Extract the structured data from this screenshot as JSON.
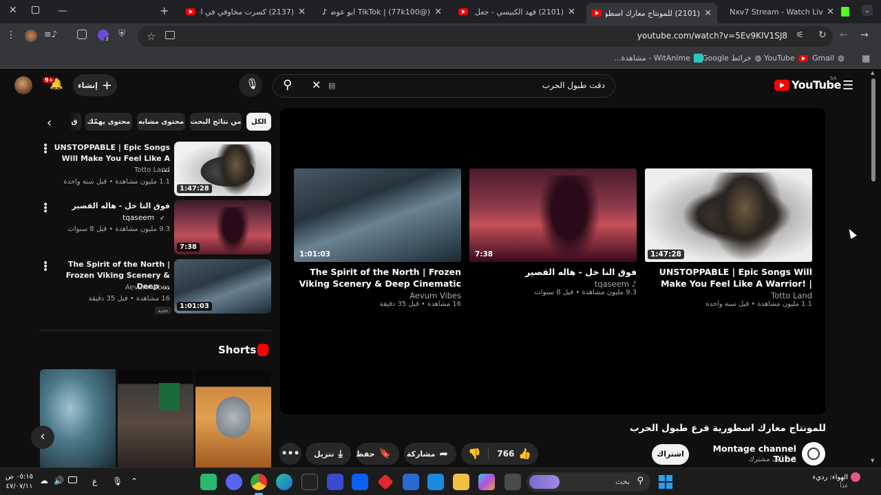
{
  "browser": {
    "tabs": [
      {
        "title": "Nxv7 Stream - Watch Live on Ki",
        "active": false
      },
      {
        "title": "(2101) للمونتاج معارك اسطورية",
        "active": true
      },
      {
        "title": "(2101) فهد الكبيسي - جعل السحا",
        "active": false
      },
      {
        "title": "TikTok | (77k100@) ابو عوضه⭐",
        "active": false
      },
      {
        "title": "(2137) كسرت مخاوفي في اخطر",
        "active": false
      }
    ],
    "url": "youtube.com/watch?v=5Ev9KlV1SJ8",
    "extension_badge": "3",
    "bookmarks": [
      {
        "label": "Gmail"
      },
      {
        "label": "YouTube"
      },
      {
        "label": "خرائط Google"
      },
      {
        "label": "WitAnime - مشاهدة..."
      }
    ]
  },
  "youtube": {
    "logo_text": "YouTube",
    "region": "SA",
    "search_query": "دقت طبول الحرب",
    "create_label": "إنشاء",
    "notif_count": "9+",
    "chips": [
      "الكل",
      "من نتائج البحث",
      "محتوى مشابه",
      "محتوى يهمّك",
      "ق"
    ],
    "sidebar_videos": [
      {
        "title": "UNSTOPPABLE | Epic Songs Will Make You Feel Like A ...",
        "channel": "Totto Land",
        "meta": "1.1 مليون مشاهدة • قبل سنة واحدة",
        "duration": "1:47:28"
      },
      {
        "title": "فوق النا خل - هاله القصير",
        "channel": "tqaseem",
        "meta": "9.3 مليون مشاهدة • قبل 8 سنوات",
        "duration": "7:38"
      },
      {
        "title": "The Spirit of the North | Frozen Viking Scenery & Deep ...",
        "channel": "Aevum Vibes",
        "meta": "16 مشاهدة • قبل 35 دقيقة",
        "duration": "1:01:03",
        "badge": "جديد"
      }
    ],
    "shorts_label": "Shorts",
    "end_cards": [
      {
        "title": "UNSTOPPABLE | Epic Songs Will Make You Feel Like A Warrior! | Epic...",
        "channel": "Totto Land",
        "meta": "1.1 مليون مشاهدة • قبل سنة واحدة",
        "duration": "1:47:28"
      },
      {
        "title": "فوق النا خل - هاله القصير",
        "channel": "tqaseem ♪",
        "meta": "9.3 مليون مشاهدة • قبل 8 سنوات",
        "duration": "7:38"
      },
      {
        "title": "The Spirit of the North | Frozen Viking Scenery & Deep Cinematic Ambience",
        "channel": "Aevum Vibes",
        "meta": "16 مشاهدة • قبل 35 دقيقة",
        "duration": "1:01:03"
      }
    ],
    "video_title": "للمونتاج معارك اسطورية قرع طبول الحرب",
    "channel_name": "Montage channel Tube",
    "subscribers": "3.3 ألف مشترك",
    "subscribe_label": "اشتراك",
    "like_count": "766",
    "share_label": "مشاركة",
    "save_label": "حفظ",
    "download_label": "تنزيل"
  },
  "taskbar": {
    "search_placeholder": "بحث",
    "weather": "الهواء: رديء",
    "weather_sub": "غداً",
    "time": "٠٥:١٥ ص",
    "date": "٤٧/٠٧/١١",
    "lang": "ع"
  },
  "colors": {
    "yt_red": "#ff0000",
    "bg": "#0f0f0f",
    "chrome": "#35363a"
  }
}
